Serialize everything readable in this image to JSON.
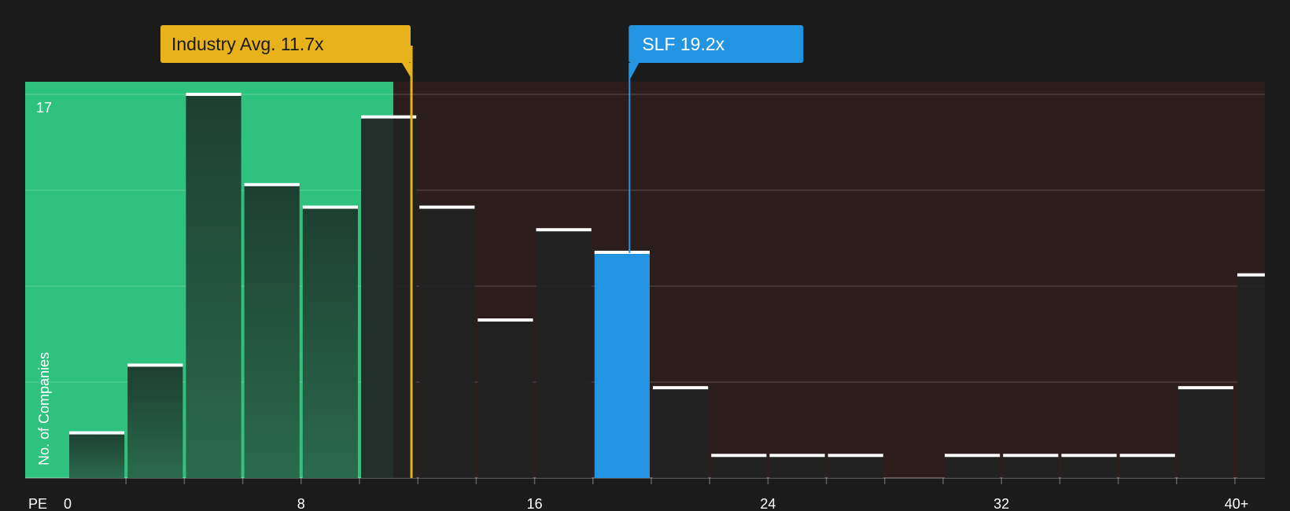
{
  "chart_data": {
    "type": "bar",
    "xlabel": "PE",
    "ylabel": "No. of Companies",
    "x_tick_labels": [
      "0",
      "8",
      "16",
      "24",
      "32",
      "40+"
    ],
    "x_tick_values": [
      0,
      8,
      16,
      24,
      32,
      40
    ],
    "y_max_label": "17",
    "ylim": [
      0,
      17.6
    ],
    "bin_width": 2,
    "bins": [
      0,
      2,
      4,
      6,
      8,
      10,
      12,
      14,
      16,
      18,
      20,
      22,
      24,
      26,
      28,
      30,
      32,
      34,
      36,
      38,
      40
    ],
    "values": [
      2,
      5,
      17,
      13,
      12,
      16,
      12,
      7,
      11,
      10,
      4,
      1,
      1,
      1,
      0,
      1,
      1,
      1,
      1,
      4,
      9
    ],
    "highlight_bin_index": 9,
    "grid": true,
    "industry_avg": {
      "value": 11.7,
      "label": "Industry Avg. 11.7x"
    },
    "company": {
      "value": 19.2,
      "label": "SLF 19.2x"
    },
    "colors": {
      "background": "#1b1b1b",
      "fair_zone": "#2ec27e",
      "over_zone": "#2d1e1e",
      "bar_dark": "#1f3a2f",
      "bar_neutral": "#222222",
      "highlight": "#2394e1",
      "industry": "#e8b21d",
      "cap": "#ffffff"
    }
  }
}
